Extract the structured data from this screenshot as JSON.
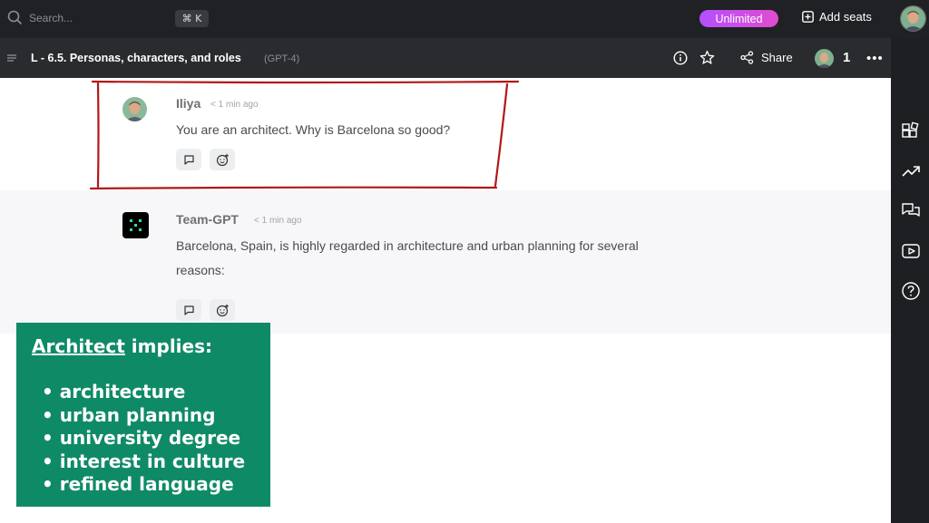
{
  "topbar": {
    "search_placeholder": "Search...",
    "shortcut": "⌘ K",
    "plan_badge": "Unlimited",
    "add_seats_label": "Add seats"
  },
  "header": {
    "title": "L - 6.5. Personas, characters, and roles",
    "model": "(GPT-4)",
    "share_label": "Share",
    "participant_count": "1"
  },
  "messages": [
    {
      "author": "Iliya",
      "time": "< 1 min ago",
      "text": "You are an architect. Why is Barcelona so good?"
    },
    {
      "author": "Team-GPT",
      "time": "< 1 min ago",
      "text_line1": "Barcelona, Spain, is highly regarded in architecture and urban planning for several",
      "text_line2": "reasons:"
    }
  ],
  "callout": {
    "heading_keyword": "Architect",
    "heading_rest": " implies:",
    "items": [
      "architecture",
      "urban planning",
      "university degree",
      "interest in culture",
      "refined language"
    ]
  },
  "colors": {
    "accent_green": "#0f8a66",
    "badge_gradient_start": "#b450ff",
    "annotation_red": "#b01818"
  },
  "icons": {
    "right_sidebar": [
      "widgets-icon",
      "trending-icon",
      "chat-icon",
      "video-icon",
      "help-icon"
    ]
  }
}
